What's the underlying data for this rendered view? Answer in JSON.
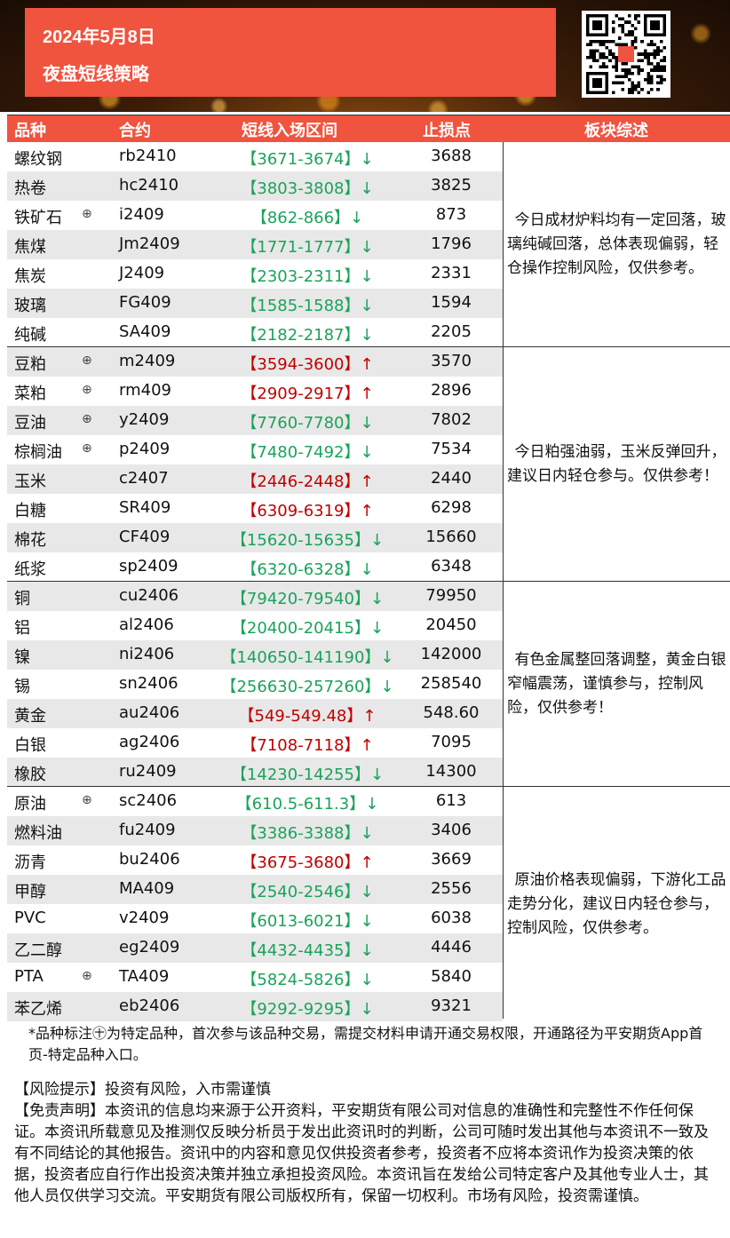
{
  "header": {
    "date": "2024年5月8日",
    "title": "夜盘短线策略"
  },
  "table": {
    "columns": [
      "品种",
      "合约",
      "短线入场区间",
      "止损点",
      "板块综述"
    ],
    "groups": [
      {
        "summary": "今日成材炉料均有一定回落，玻璃纯碱回落，总体表现偏弱，轻仓操作控制风险，仅供参考。",
        "rows": [
          {
            "name": "螺纹钢",
            "mark": "",
            "code": "rb2410",
            "range": "【3671-3674】↓",
            "dir": "down",
            "stop": "3688"
          },
          {
            "name": "热卷",
            "mark": "",
            "code": "hc2410",
            "range": "【3803-3808】↓",
            "dir": "down",
            "stop": "3825"
          },
          {
            "name": "铁矿石",
            "mark": "⊕",
            "code": "i2409",
            "range": "【862-866】↓",
            "dir": "down",
            "stop": "873"
          },
          {
            "name": "焦煤",
            "mark": "",
            "code": "Jm2409",
            "range": "【1771-1777】↓",
            "dir": "down",
            "stop": "1796"
          },
          {
            "name": "焦炭",
            "mark": "",
            "code": "J2409",
            "range": "【2303-2311】↓",
            "dir": "down",
            "stop": "2331"
          },
          {
            "name": "玻璃",
            "mark": "",
            "code": "FG409",
            "range": "【1585-1588】↓",
            "dir": "down",
            "stop": "1594"
          },
          {
            "name": "纯碱",
            "mark": "",
            "code": "SA409",
            "range": "【2182-2187】↓",
            "dir": "down",
            "stop": "2205"
          }
        ]
      },
      {
        "summary": "今日粕强油弱，玉米反弹回升，建议日内轻仓参与。仅供参考！",
        "rows": [
          {
            "name": "豆粕",
            "mark": "⊕",
            "code": "m2409",
            "range": "【3594-3600】↑",
            "dir": "up",
            "stop": "3570"
          },
          {
            "name": "菜粕",
            "mark": "⊕",
            "code": "rm409",
            "range": "【2909-2917】↑",
            "dir": "up",
            "stop": "2896"
          },
          {
            "name": "豆油",
            "mark": "⊕",
            "code": "y2409",
            "range": "【7760-7780】↓",
            "dir": "down",
            "stop": "7802"
          },
          {
            "name": "棕榈油",
            "mark": "⊕",
            "code": "p2409",
            "range": "【7480-7492】↓",
            "dir": "down",
            "stop": "7534"
          },
          {
            "name": "玉米",
            "mark": "",
            "code": "c2407",
            "range": "【2446-2448】↑",
            "dir": "up",
            "stop": "2440"
          },
          {
            "name": "白糖",
            "mark": "",
            "code": "SR409",
            "range": "【6309-6319】↑",
            "dir": "up",
            "stop": "6298"
          },
          {
            "name": "棉花",
            "mark": "",
            "code": "CF409",
            "range": "【15620-15635】↓",
            "dir": "down",
            "stop": "15660"
          },
          {
            "name": "纸浆",
            "mark": "",
            "code": "sp2409",
            "range": "【6320-6328】↓",
            "dir": "down",
            "stop": "6348"
          }
        ]
      },
      {
        "summary": "有色金属整回落调整，黄金白银窄幅震荡，谨慎参与，控制风险，仅供参考！",
        "rows": [
          {
            "name": "铜",
            "mark": "",
            "code": "cu2406",
            "range": "【79420-79540】↓",
            "dir": "down",
            "stop": "79950"
          },
          {
            "name": "铝",
            "mark": "",
            "code": "al2406",
            "range": "【20400-20415】↓",
            "dir": "down",
            "stop": "20450"
          },
          {
            "name": "镍",
            "mark": "",
            "code": "ni2406",
            "range": "【140650-141190】↓",
            "dir": "down",
            "stop": "142000"
          },
          {
            "name": "锡",
            "mark": "",
            "code": "sn2406",
            "range": "【256630-257260】↓",
            "dir": "down",
            "stop": "258540"
          },
          {
            "name": "黄金",
            "mark": "",
            "code": "au2406",
            "range": "【549-549.48】↑",
            "dir": "up",
            "stop": "548.60"
          },
          {
            "name": "白银",
            "mark": "",
            "code": "ag2406",
            "range": "【7108-7118】↑",
            "dir": "up",
            "stop": "7095"
          },
          {
            "name": "橡胶",
            "mark": "",
            "code": "ru2409",
            "range": "【14230-14255】↓",
            "dir": "down",
            "stop": "14300"
          }
        ]
      },
      {
        "summary": "原油价格表现偏弱，下游化工品走势分化，建议日内轻仓参与，控制风险，仅供参考。",
        "rows": [
          {
            "name": "原油",
            "mark": "⊕",
            "code": "sc2406",
            "range": "【610.5-611.3】↓",
            "dir": "down",
            "stop": "613"
          },
          {
            "name": "燃料油",
            "mark": "",
            "code": "fu2409",
            "range": "【3386-3388】↓",
            "dir": "down",
            "stop": "3406"
          },
          {
            "name": "沥青",
            "mark": "",
            "code": "bu2406",
            "range": "【3675-3680】↑",
            "dir": "up",
            "stop": "3669"
          },
          {
            "name": "甲醇",
            "mark": "",
            "code": "MA409",
            "range": "【2540-2546】↓",
            "dir": "down",
            "stop": "2556"
          },
          {
            "name": "PVC",
            "mark": "",
            "code": "v2409",
            "range": "【6013-6021】↓",
            "dir": "down",
            "stop": "6038"
          },
          {
            "name": "乙二醇",
            "mark": "",
            "code": "eg2409",
            "range": "【4432-4435】↓",
            "dir": "down",
            "stop": "4446"
          },
          {
            "name": "PTA",
            "mark": "⊕",
            "code": "TA409",
            "range": "【5824-5826】↓",
            "dir": "down",
            "stop": "5840"
          },
          {
            "name": "苯乙烯",
            "mark": "",
            "code": "eb2406",
            "range": "【9292-9295】↓",
            "dir": "down",
            "stop": "9321"
          }
        ]
      }
    ]
  },
  "colors": {
    "header_red": "#f0533e",
    "up": "#c00000",
    "down": "#1aa35a",
    "alt_row": "#e8e8e8"
  },
  "footer": {
    "note": "*品种标注㊉为特定品种，首次参与该品种交易，需提交材料申请开通交易权限，开通路径为平安期货App首页-特定品种入口。",
    "risk": "【风险提示】投资有风险，入市需谨慎",
    "disclaimer": "【免责声明】本资讯的信息均来源于公开资料，平安期货有限公司对信息的准确性和完整性不作任何保证。本资讯所载意见及推测仅反映分析员于发出此资讯时的判断，公司可随时发出其他与本资讯不一致及有不同结论的其他报告。资讯中的内容和意见仅供投资者参考，投资者不应将本资讯作为投资决策的依据，投资者应自行作出投资决策并独立承担投资风险。本资讯旨在发给公司特定客户及其他专业人士，其他人员仅供学习交流。平安期货有限公司版权所有，保留一切权利。市场有风险，投资需谨慎。"
  },
  "icons": {
    "qr": "qr-code-icon",
    "special_mark": "circled-plus-icon"
  }
}
